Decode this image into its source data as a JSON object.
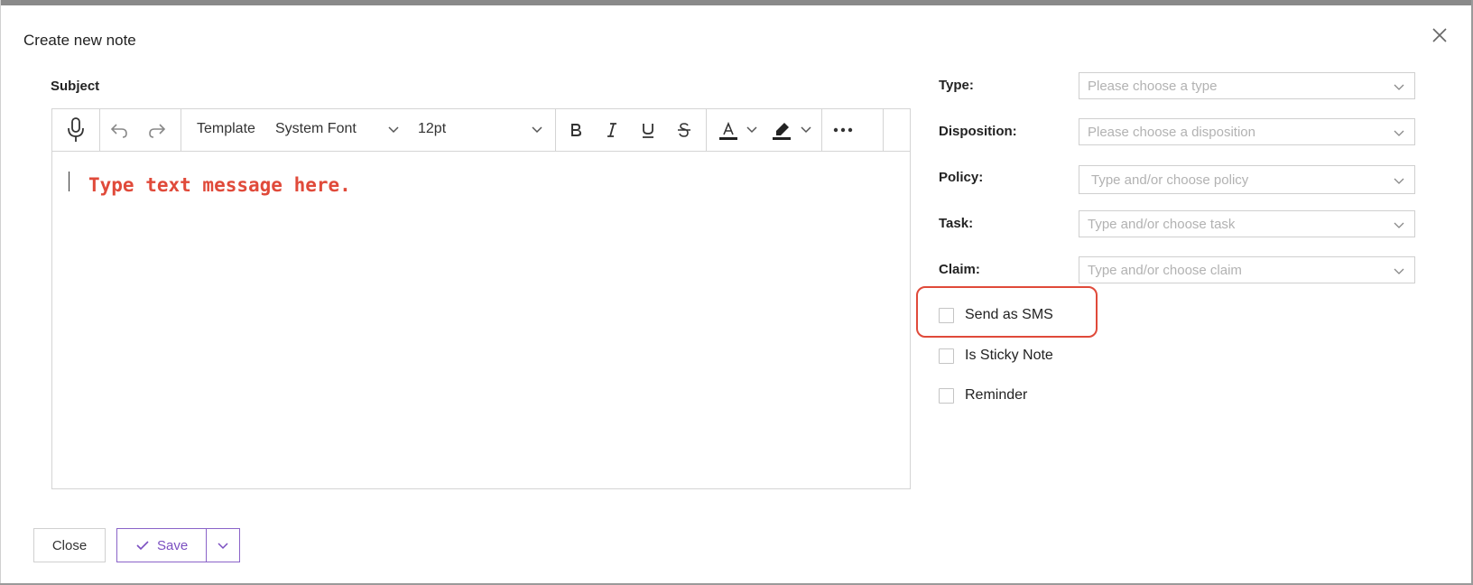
{
  "dialog": {
    "title": "Create new note"
  },
  "editor": {
    "subject_label": "Subject",
    "toolbar": {
      "template_label": "Template",
      "font_family": "System Font",
      "font_size": "12pt"
    },
    "placeholder": "Type text message here."
  },
  "fields": [
    {
      "label": "Type",
      "placeholder": "Please choose a type"
    },
    {
      "label": "Disposition",
      "placeholder": "Please choose a disposition"
    },
    {
      "label": "Policy",
      "placeholder": "Type and/or choose policy"
    },
    {
      "label": "Task",
      "placeholder": "Type and/or choose task"
    },
    {
      "label": "Claim",
      "placeholder": "Type and/or choose claim"
    }
  ],
  "options": [
    {
      "label": "Send as SMS",
      "checked": false,
      "highlighted": true
    },
    {
      "label": "Is Sticky Note",
      "checked": false
    },
    {
      "label": "Reminder",
      "checked": false
    }
  ],
  "footer": {
    "close_label": "Close",
    "save_label": "Save"
  },
  "colors": {
    "accent": "#7b4fc1",
    "highlight": "#e04a3a",
    "placeholder_text": "#e04a3a"
  },
  "icons": [
    "close-icon",
    "microphone-icon",
    "undo-icon",
    "redo-icon",
    "bold-icon",
    "italic-icon",
    "underline-icon",
    "strikethrough-icon",
    "font-color-icon",
    "highlight-color-icon",
    "more-icon",
    "chevron-down-icon",
    "check-icon"
  ]
}
